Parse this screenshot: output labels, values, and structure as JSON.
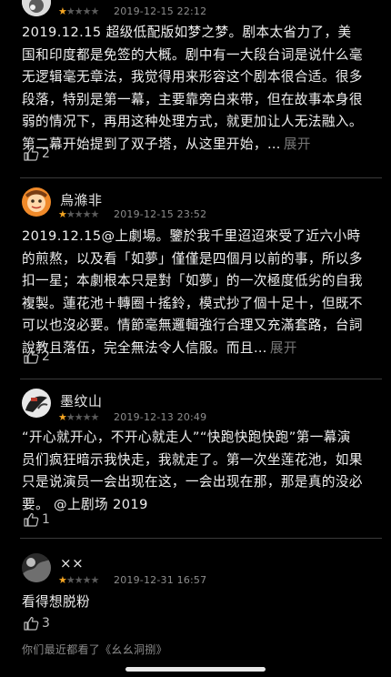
{
  "reviews": [
    {
      "username": "",
      "date": "2019-12-15 22:12",
      "rating": 1,
      "content": "2019.12.15 超级低配版如梦之梦。剧本太省力了，美国和印度都是免签的大概。剧中有一大段台词是说什么毫无逻辑毫无章法，我觉得用来形容这个剧本很合适。很多段落，特别是第一幕，主要靠旁白来带，但在故事本身很弱的情况下，再用这种处理方式，就更加让人无法融入。第二幕开始提到了双子塔，从这里开始，…",
      "expand_label": "展开",
      "likes": "2"
    },
    {
      "username": "烏滌非",
      "date": "2019-12-15 23:52",
      "rating": 1,
      "content": "2019.12.15@上劇場。鑒於我千里迢迢來受了近六小時的煎熬，以及看「如夢」僅僅是四個月以前的事，所以多扣一星；本劇根本只是對「如夢」的一次極度低劣的自我複製。蓮花池＋轉圈＋搖鈴，模式抄了個十足十，但既不可以也沒必要。情節毫無邏輯強行合理又充滿套路，台詞說教且落伍，完全無法令人信服。而且…",
      "expand_label": "展开",
      "likes": "2"
    },
    {
      "username": "墨纹山",
      "date": "2019-12-13 20:49",
      "rating": 1,
      "content": "“开心就开心，不开心就走人”“快跑快跑快跑”第一幕演员们疯狂暗示我快走，我就走了。第一次坐莲花池，如果只是说演员一会出现在这，一会出现在那，那是真的没必要。 @上剧场 2019",
      "expand_label": "",
      "likes": "1"
    },
    {
      "username": "××",
      "date": "2019-12-31 16:57",
      "rating": 1,
      "content": "看得想脱粉",
      "expand_label": "",
      "likes": "3"
    }
  ],
  "footer": {
    "recently_watched": "你们最近都看了《幺幺洞捌》"
  },
  "icons": {
    "like": "thumbs-up-icon",
    "star": "star-icon"
  },
  "colors": {
    "background": "#000000",
    "star_active": "#f5a623",
    "star_inactive": "#5b5b5b",
    "meta_text": "#8d8d8d"
  }
}
